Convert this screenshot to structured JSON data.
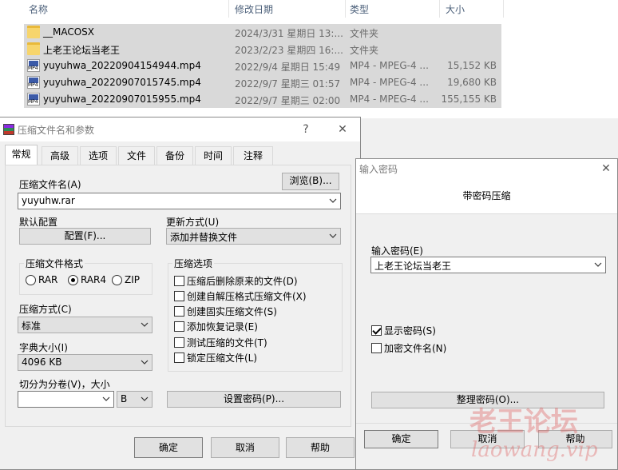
{
  "explorer": {
    "headers": {
      "name": "名称",
      "modified": "修改日期",
      "type": "类型",
      "size": "大小"
    },
    "files": [
      {
        "icon": "folder-icon",
        "name": "__MACOSX",
        "date": "2024/3/31 星期日 13:...",
        "type": "文件夹",
        "size": ""
      },
      {
        "icon": "folder-icon",
        "name": "上老王论坛当老王",
        "date": "2023/2/23 星期四 16:...",
        "type": "文件夹",
        "size": ""
      },
      {
        "icon": "mp4-icon",
        "name": "yuyuhwa_20220904154944.mp4",
        "date": "2022/9/4 星期日 15:49",
        "type": "MP4 - MPEG-4 ...",
        "size": "15,152 KB"
      },
      {
        "icon": "mp4-icon",
        "name": "yuyuhwa_20220907015745.mp4",
        "date": "2022/9/7 星期三 01:57",
        "type": "MP4 - MPEG-4 ...",
        "size": "19,680 KB"
      },
      {
        "icon": "mp4-icon",
        "name": "yuyuhwa_20220907015955.mp4",
        "date": "2022/9/7 星期三 02:00",
        "type": "MP4 - MPEG-4 ...",
        "size": "155,155 KB"
      }
    ]
  },
  "archive_dialog": {
    "title": "压缩文件名和参数",
    "help_glyph": "?",
    "close_glyph": "✕",
    "tabs": [
      "常规",
      "高级",
      "选项",
      "文件",
      "备份",
      "时间",
      "注释"
    ],
    "archive_name_label": "压缩文件名(A)",
    "browse_button": "浏览(B)...",
    "archive_name_value": "yuyuhw.rar",
    "default_profile_label": "默认配置",
    "profiles_button": "配置(F)...",
    "update_mode_label": "更新方式(U)",
    "update_mode_value": "添加并替换文件",
    "format_group": "压缩文件格式",
    "formats": [
      {
        "label": "RAR",
        "selected": false
      },
      {
        "label": "RAR4",
        "selected": true
      },
      {
        "label": "ZIP",
        "selected": false
      }
    ],
    "options_group": "压缩选项",
    "options": [
      {
        "label": "压缩后删除原来的文件(D)",
        "checked": false
      },
      {
        "label": "创建自解压格式压缩文件(X)",
        "checked": false
      },
      {
        "label": "创建固实压缩文件(S)",
        "checked": false
      },
      {
        "label": "添加恢复记录(E)",
        "checked": false
      },
      {
        "label": "测试压缩的文件(T)",
        "checked": false
      },
      {
        "label": "锁定压缩文件(L)",
        "checked": false
      }
    ],
    "method_label": "压缩方式(C)",
    "method_value": "标准",
    "dict_label": "字典大小(I)",
    "dict_value": "4096 KB",
    "split_label": "切分为分卷(V)，大小",
    "split_value": "",
    "split_unit": "B",
    "set_password_button": "设置密码(P)...",
    "ok_button": "确定",
    "cancel_button": "取消",
    "help_button": "帮助"
  },
  "password_dialog": {
    "title": "输入密码",
    "close_glyph": "✕",
    "heading": "带密码压缩",
    "password_label": "输入密码(E)",
    "password_value": "上老王论坛当老王",
    "show_password": {
      "label": "显示密码(S)",
      "checked": true
    },
    "encrypt_names": {
      "label": "加密文件名(N)",
      "checked": false
    },
    "organize_button": "整理密码(O)...",
    "ok_button": "确定",
    "cancel_button": "取消",
    "help_button": "帮助"
  },
  "watermark": {
    "line1": "老王论坛",
    "line2": "laowang.vip"
  }
}
